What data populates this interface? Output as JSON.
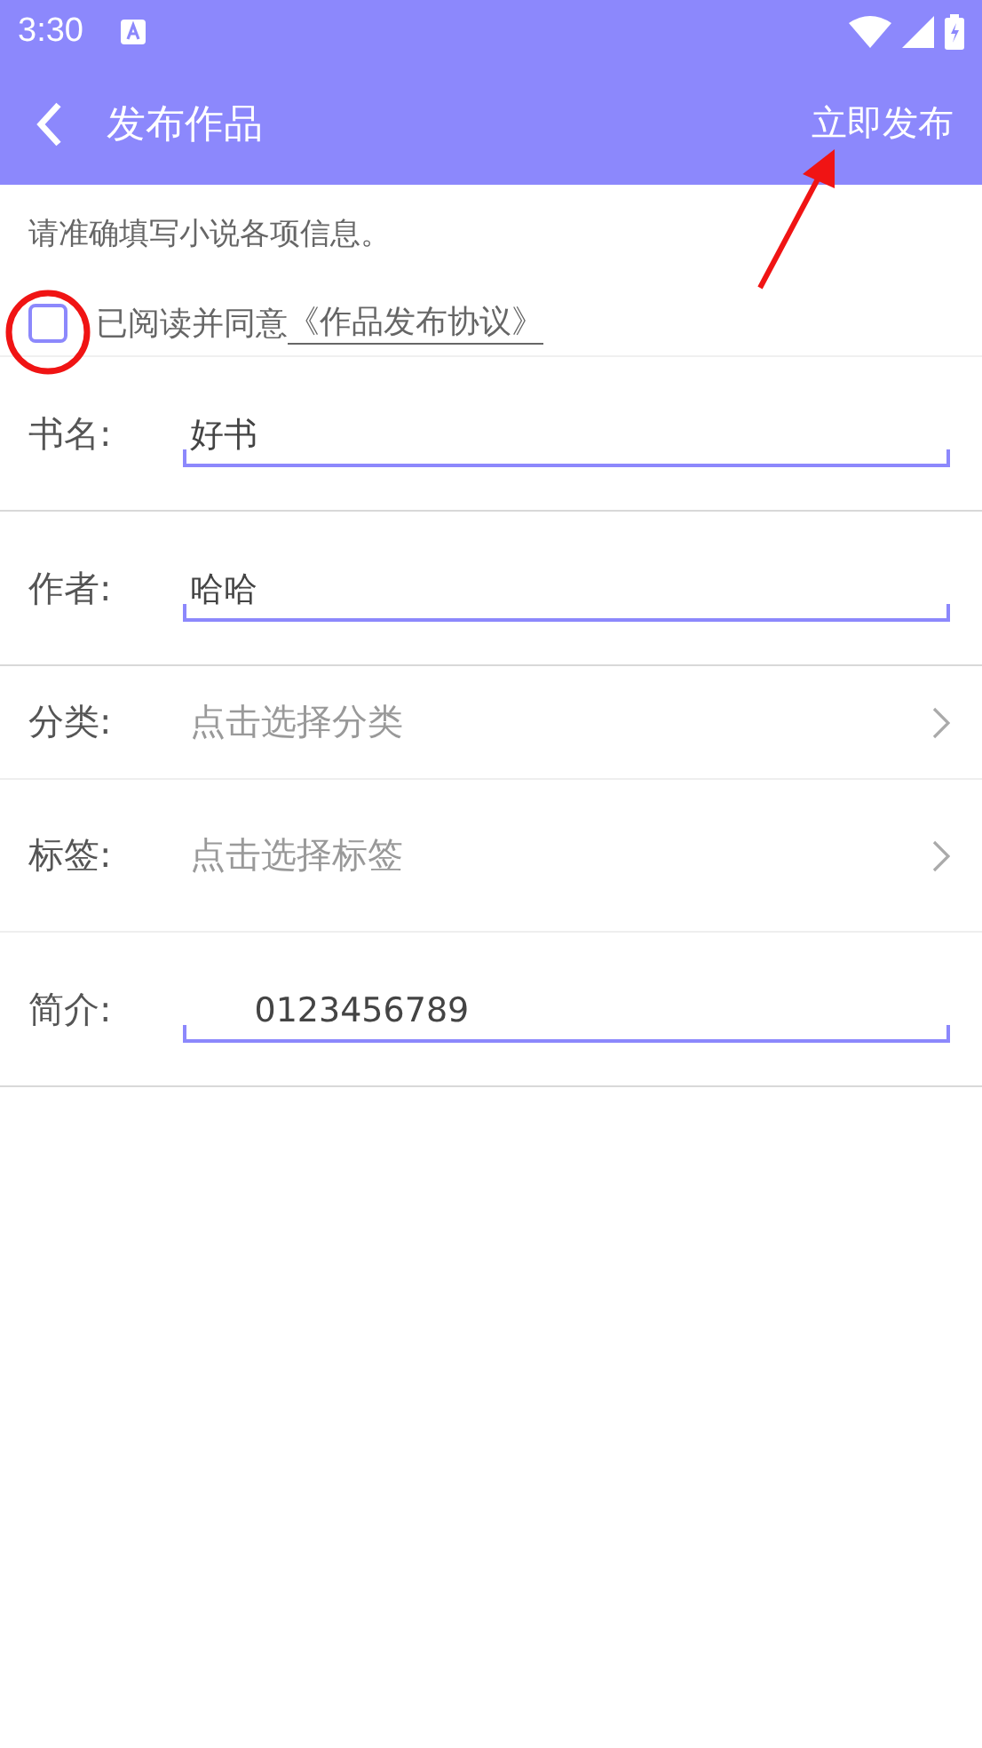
{
  "status_bar": {
    "time": "3:30"
  },
  "app_bar": {
    "title": "发布作品",
    "action": "立即发布"
  },
  "notice": "请准确填写小说各项信息。",
  "agreement": {
    "checked": false,
    "text": "已阅读并同意",
    "link": "《作品发布协议》"
  },
  "fields": [
    {
      "kind": "input",
      "label": "书名:",
      "value": "好书"
    },
    {
      "kind": "input",
      "label": "作者:",
      "value": "哈哈"
    },
    {
      "kind": "picker",
      "label": "分类:",
      "placeholder": "点击选择分类"
    },
    {
      "kind": "picker",
      "label": "标签:",
      "placeholder": "点击选择标签"
    },
    {
      "kind": "input",
      "label": "简介:",
      "value": "      0123456789"
    }
  ]
}
